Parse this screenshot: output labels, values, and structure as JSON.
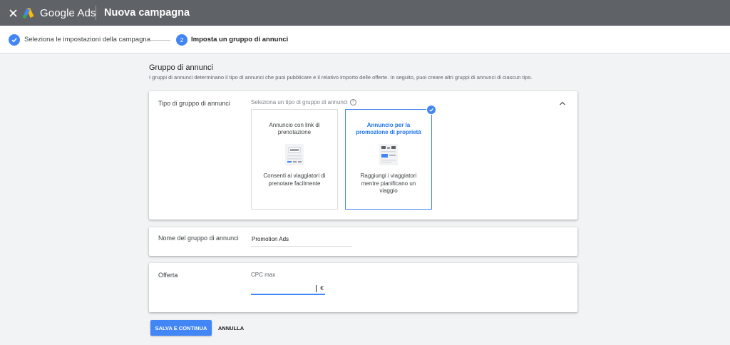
{
  "header": {
    "brand": "Google Ads",
    "campaign_title": "Nuova campagna",
    "close_icon": "close-icon",
    "logo_icon": "google-ads-logo"
  },
  "stepper": {
    "step1_label": "Seleziona le impostazioni della campagna",
    "step2_number": "2",
    "step2_label": "Imposta un gruppo di annunci"
  },
  "section": {
    "title": "Gruppo di annunci",
    "description": "I gruppi di annunci determinano il tipo di annunci che puoi pubblicare e il relativo importo delle offerte. In seguito, puoi creare altri gruppi di annunci di ciascun tipo."
  },
  "ad_group_type": {
    "label": "Tipo di gruppo di annunci",
    "hint": "Seleziona un tipo di gruppo di annunci",
    "options": [
      {
        "title": "Annuncio con link di prenotazione",
        "description": "Consenti ai viaggiatori di prenotare facilmente",
        "selected": false
      },
      {
        "title": "Annuncio per la promozione di proprietà",
        "description": "Raggiungi i viaggiatori mentre pianificano un viaggio",
        "selected": true
      }
    ]
  },
  "ad_group_name": {
    "label": "Nome del gruppo di annunci",
    "value": "Promotion Ads"
  },
  "bid": {
    "label": "Offerta",
    "field_label": "CPC max",
    "value": "",
    "currency": "€"
  },
  "actions": {
    "save_label": "SALVA E CONTINUA",
    "cancel_label": "ANNULLA"
  },
  "colors": {
    "topbar": "#5f6368",
    "accent": "#4285f4",
    "background": "#f1f3f4"
  }
}
